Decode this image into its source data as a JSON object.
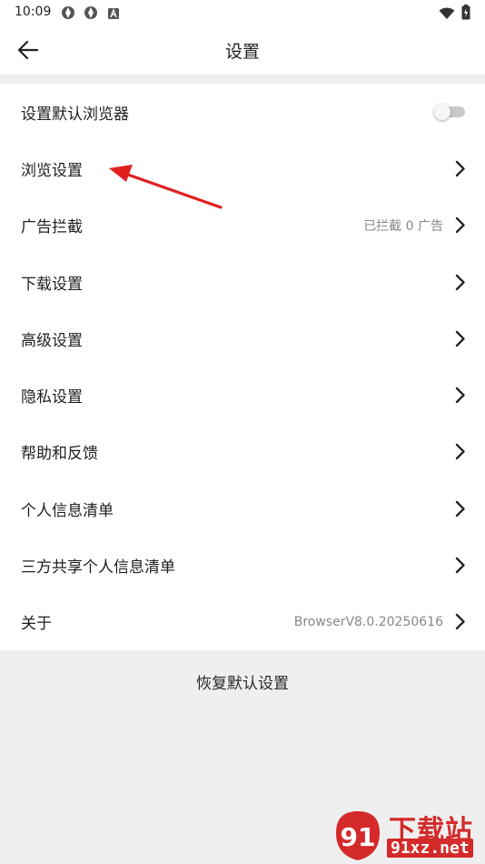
{
  "status_bar": {
    "time": "10:09",
    "left_icons": [
      "app-icon",
      "app-icon",
      "android-icon"
    ],
    "right_icons": [
      "wifi-icon",
      "battery-icon"
    ]
  },
  "header": {
    "title": "设置",
    "back_icon": "back-arrow-icon"
  },
  "settings": {
    "items": [
      {
        "label": "设置默认浏览器",
        "type": "toggle",
        "checked": false
      },
      {
        "label": "浏览设置",
        "type": "link"
      },
      {
        "label": "广告拦截",
        "type": "link",
        "value": "已拦截 0 广告"
      },
      {
        "label": "下载设置",
        "type": "link"
      },
      {
        "label": "高级设置",
        "type": "link"
      },
      {
        "label": "隐私设置",
        "type": "link"
      },
      {
        "label": "帮助和反馈",
        "type": "link"
      },
      {
        "label": "个人信息清单",
        "type": "link"
      },
      {
        "label": "三方共享个人信息清单",
        "type": "link"
      },
      {
        "label": "关于",
        "type": "link",
        "value": "BrowserV8.0.20250616"
      }
    ]
  },
  "footer": {
    "reset_label": "恢复默认设置"
  },
  "watermark": {
    "title": "下载站",
    "url": "91xz.net",
    "logo_text": "91"
  },
  "colors": {
    "background": "#efefef",
    "surface": "#ffffff",
    "annotation_arrow": "#e02020",
    "watermark_red": "#d42a2a"
  }
}
